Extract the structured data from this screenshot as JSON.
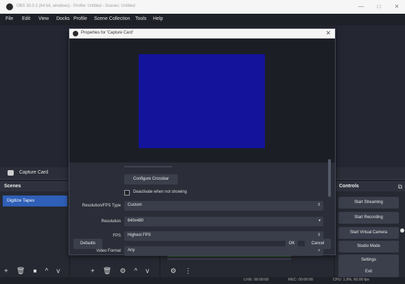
{
  "window": {
    "title": "OBS 30.0.2 (64 bit, windows) - Profile: Untitled - Scenes: Untitled",
    "minimize": "—",
    "maximize": "□",
    "close": "✕"
  },
  "menu": {
    "file": "File",
    "edit": "Edit",
    "view": "View",
    "docks": "Docks",
    "profile": "Profile",
    "scene_collection": "Scene Collection",
    "tools": "Tools",
    "help": "Help"
  },
  "source_bar": {
    "label": "Capture Card"
  },
  "scenes": {
    "header": "Scenes",
    "items": [
      "Digitize Tapes"
    ]
  },
  "controls": {
    "header": "Controls",
    "start_streaming": "Start Streaming",
    "start_recording": "Start Recording",
    "start_virtual_camera": "Start Virtual Camera",
    "studio_mode": "Studio Mode",
    "settings": "Settings",
    "exit": "Exit"
  },
  "dialog": {
    "title": "Properties for 'Capture Card'",
    "configure_crossbar": "Configure Crossbar",
    "deactivate_label": "Deactivate when not showing",
    "rows": [
      {
        "label": "Resolution/FPS Type",
        "value": "Custom"
      },
      {
        "label": "Resolution",
        "value": "640x480"
      },
      {
        "label": "FPS",
        "value": "Highest FPS"
      },
      {
        "label": "Video Format",
        "value": "Any"
      }
    ],
    "defaults_button": "Defaults",
    "ok_button": "OK",
    "cancel_button": "Cancel"
  },
  "toolbar_icons": {
    "scenes": [
      "+",
      "🗑",
      "⏹",
      "^",
      "v"
    ],
    "sources": [
      "+",
      "🗑",
      "⚙",
      "^",
      "v"
    ],
    "mixer": [
      "⚙",
      "⋮"
    ]
  },
  "statusbar": {
    "live": "LIVE: 00:00:00",
    "rec": "REC: 00:00:00",
    "cpu": "CPU: 1.9%, 60.00 fps"
  }
}
